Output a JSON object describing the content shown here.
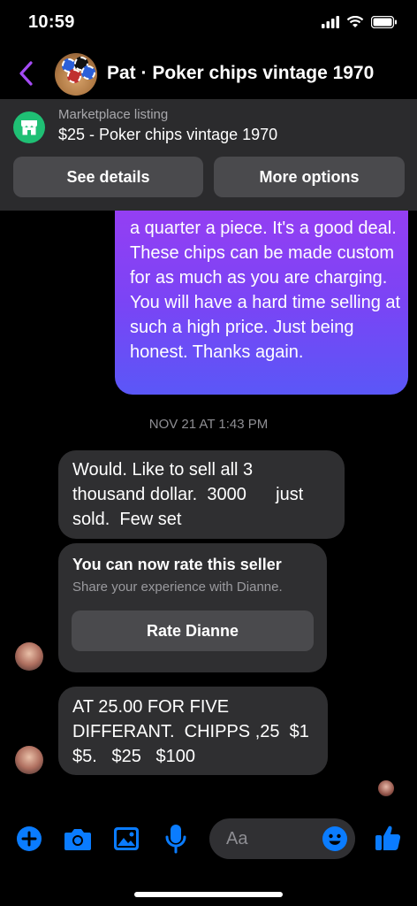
{
  "status": {
    "time": "10:59"
  },
  "header": {
    "title": "Pat · Poker chips vintage 1970"
  },
  "listing": {
    "label": "Marketplace listing",
    "title": "$25 - Poker chips vintage 1970",
    "see_details": "See details",
    "more_options": "More options"
  },
  "messages": {
    "sent_text": "a quarter a piece. It's a good deal. These chips can be made custom for as much as you are charging. You will have a hard time selling at such a high price. Just being honest. Thanks again.",
    "timestamp": "NOV 21 AT 1:43 PM",
    "received_1": "Would. Like to sell all 3\nthousand dollar.  3000      just\nsold.  Few set",
    "rate_card": {
      "title": "You can now rate this seller",
      "subtitle": "Share your experience with Dianne.",
      "button": "Rate Dianne"
    },
    "received_2": "AT 25.00 FOR FIVE\nDIFFERANT.  CHIPPS ,25  $1\n$5.   $25   $100"
  },
  "composer": {
    "placeholder": "Aa"
  },
  "colors": {
    "accent": "#0a7cff",
    "sent_gradient_top": "#9b3df2",
    "sent_gradient_bottom": "#5a57f7",
    "marketplace_green": "#1fbf74"
  },
  "icons": [
    "back-chevron-icon",
    "storefront-icon",
    "plus-icon",
    "camera-icon",
    "image-icon",
    "microphone-icon",
    "emoji-icon",
    "thumbs-up-icon"
  ]
}
